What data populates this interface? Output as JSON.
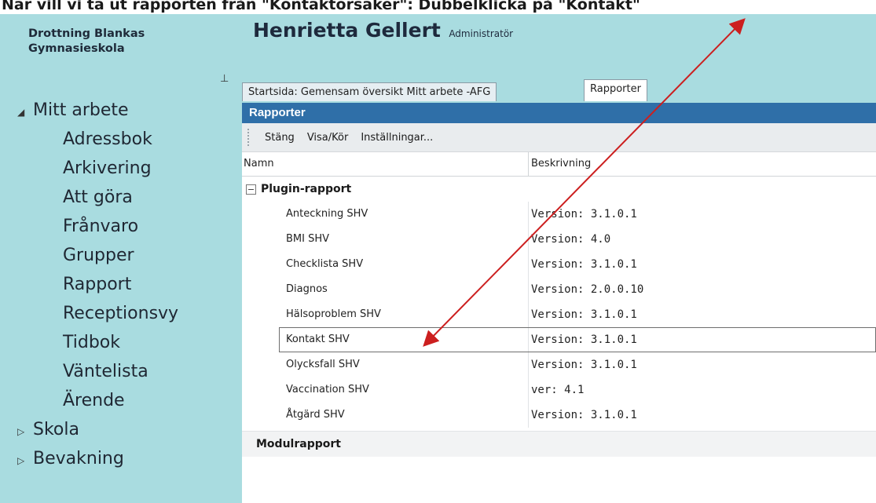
{
  "instruction": "Nar vill vi ta ut rapporten från \"Kontaktorsaker\": Dubbelklicka på \"Kontakt\"",
  "school": {
    "line1": "Drottning Blankas",
    "line2": "Gymnasieskola"
  },
  "user": {
    "name": "Henrietta Gellert",
    "role": "Administratör"
  },
  "pin_icon": "pin-icon",
  "nav": {
    "mitt_arbete": "Mitt arbete",
    "items": [
      "Adressbok",
      "Arkivering",
      "Att göra",
      "Frånvaro",
      "Grupper",
      "Rapport",
      "Receptionsvy",
      "Tidbok",
      "Väntelista",
      "Ärende"
    ],
    "skola": "Skola",
    "bevakning": "Bevakning"
  },
  "tabs": [
    {
      "label": "Startsida: Gemensam översikt Mitt arbete -AFG"
    },
    {
      "label": "Rapporter"
    }
  ],
  "panel": {
    "title": "Rapporter",
    "toolbar": {
      "stang": "Stäng",
      "visa": "Visa/Kör",
      "installningar": "Inställningar..."
    },
    "columns": {
      "name": "Namn",
      "description": "Beskrivning"
    },
    "group1": {
      "expander": "−",
      "label": "Plugin-rapport"
    },
    "rows": [
      {
        "name": "Anteckning SHV",
        "desc": "Version: 3.1.0.1"
      },
      {
        "name": "BMI SHV",
        "desc": "Version:  4.0"
      },
      {
        "name": "Checklista SHV",
        "desc": "Version: 3.1.0.1"
      },
      {
        "name": "Diagnos",
        "desc": "Version: 2.0.0.10"
      },
      {
        "name": "Hälsoproblem SHV",
        "desc": "Version: 3.1.0.1"
      },
      {
        "name": "Kontakt SHV",
        "desc": "Version: 3.1.0.1"
      },
      {
        "name": "Olycksfall SHV",
        "desc": "Version: 3.1.0.1"
      },
      {
        "name": "Vaccination SHV",
        "desc": "ver: 4.1"
      },
      {
        "name": "Åtgärd SHV",
        "desc": "Version: 3.1.0.1"
      }
    ],
    "group2": {
      "label": "Modulrapport"
    }
  },
  "colors": {
    "sidebar_bg": "#a9dce0",
    "title_bar": "#2f6fa8",
    "arrow": "#cc1f1f"
  }
}
